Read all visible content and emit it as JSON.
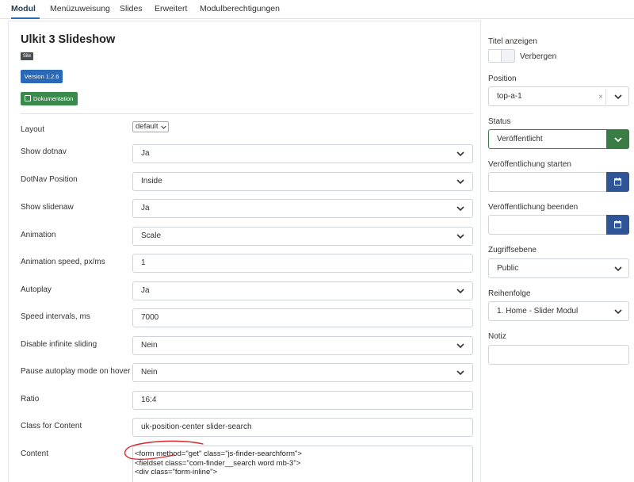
{
  "tabs": [
    "Modul",
    "Menüzuweisung",
    "Slides",
    "Erweitert",
    "Modulberechtigungen"
  ],
  "module": {
    "title": "Ulkit 3 Slideshow",
    "site_badge": "Site",
    "version_button": "Version 1.2.6",
    "doc_button": "Dokumentation"
  },
  "form": {
    "layout": {
      "label": "Layout",
      "value": "default"
    },
    "fields": [
      {
        "label": "Show dotnav",
        "value": "Ja",
        "type": "select"
      },
      {
        "label": "DotNav Position",
        "value": "Inside",
        "type": "select"
      },
      {
        "label": "Show slidenaw",
        "value": "Ja",
        "type": "select"
      },
      {
        "label": "Animation",
        "value": "Scale",
        "type": "select"
      },
      {
        "label": "Animation speed, px/ms",
        "value": "1",
        "type": "text"
      },
      {
        "label": "Autoplay",
        "value": "Ja",
        "type": "select"
      },
      {
        "label": "Speed intervals, ms",
        "value": "7000",
        "type": "text"
      },
      {
        "label": "Disable infinite sliding",
        "value": "Nein",
        "type": "select"
      },
      {
        "label": "Pause autoplay mode on hover",
        "value": "Nein",
        "type": "select"
      },
      {
        "label": "Ratio",
        "value": "16:4",
        "type": "text"
      },
      {
        "label": "Class for Content",
        "value": "uk-position-center slider-search",
        "type": "text"
      }
    ],
    "content": {
      "label": "Content",
      "lines": [
        "<form method=\"get\" class=\"js-finder-searchform\">",
        "<fieldset class=\"com-finder__search word mb-3\">",
        "<div class=\"form-inline\">"
      ]
    }
  },
  "sidebar": {
    "title_show": {
      "label": "Titel anzeigen",
      "toggle_label": "Verbergen"
    },
    "position": {
      "label": "Position",
      "value": "top-a-1",
      "clear": "×"
    },
    "status": {
      "label": "Status",
      "value": "Veröffentlicht"
    },
    "publish_start": {
      "label": "Veröffentlichung starten",
      "value": ""
    },
    "publish_end": {
      "label": "Veröffentlichung beenden",
      "value": ""
    },
    "access": {
      "label": "Zugriffsebene",
      "value": "Public"
    },
    "order": {
      "label": "Reihenfolge",
      "value": "1. Home - Slider Modul"
    },
    "note": {
      "label": "Notiz",
      "value": ""
    }
  },
  "colors": {
    "primary": "#2a69b8",
    "success": "#3a8b4b",
    "status_green": "#3a7d44",
    "calendar_blue": "#2f5597",
    "annotation_red": "#d9262c"
  }
}
